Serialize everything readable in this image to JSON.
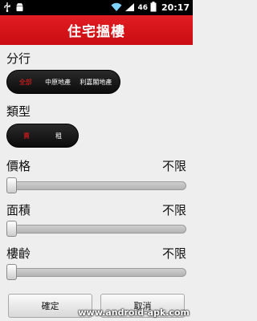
{
  "status_bar": {
    "icons": [
      "usb-icon",
      "android-debug-icon",
      "wifi-icon",
      "signal-icon",
      "battery-icon"
    ],
    "network": "46",
    "time": "20:17"
  },
  "header": {
    "title": "住宅搵樓"
  },
  "district": {
    "label": "分行",
    "options": [
      "全部",
      "中原地產",
      "利嘉閣地產"
    ],
    "selected": "全部"
  },
  "type": {
    "label": "類型",
    "options": [
      "賣",
      "租"
    ],
    "selected": "賣"
  },
  "filters": [
    {
      "label": "價格",
      "value": "不限",
      "level": 0
    },
    {
      "label": "面積",
      "value": "不限",
      "level": 0
    },
    {
      "label": "樓齡",
      "value": "不限",
      "level": 0
    }
  ],
  "buttons": {
    "confirm": "確定",
    "cancel": "取消"
  },
  "watermark": "www.android-apk.com",
  "colors": {
    "accent": "#e11d22",
    "selected_text": "#ff1b1b",
    "statusbar": "#000000"
  }
}
